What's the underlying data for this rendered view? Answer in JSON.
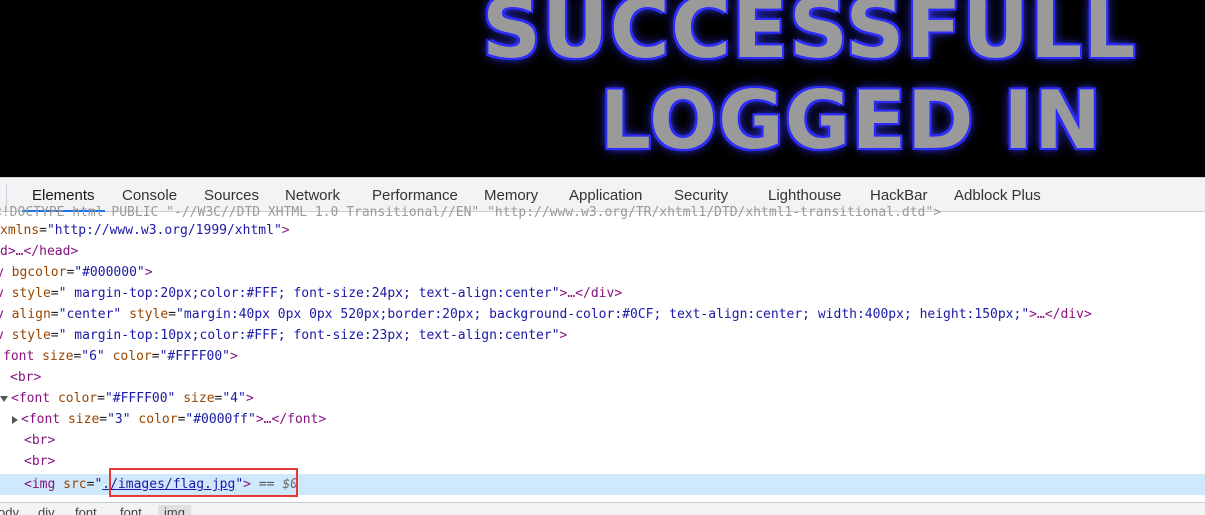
{
  "banner": {
    "line1": "SUCCESSFULL",
    "line2": "LOGGED IN"
  },
  "devtools": {
    "tabs": [
      {
        "label": "Elements",
        "active": true
      },
      {
        "label": "Console"
      },
      {
        "label": "Sources"
      },
      {
        "label": "Network"
      },
      {
        "label": "Performance"
      },
      {
        "label": "Memory"
      },
      {
        "label": "Application"
      },
      {
        "label": "Security"
      },
      {
        "label": "Lighthouse"
      },
      {
        "label": "HackBar"
      },
      {
        "label": "Adblock Plus"
      }
    ],
    "dom": {
      "line0": "<!DOCTYPE html PUBLIC \"-//W3C//DTD XHTML 1.0 Transitional//EN\" \"http://www.w3.org/TR/xhtml1/DTD/xhtml1-transitional.dtd\">",
      "line1_attr": "xmlns",
      "line1_val": "\"http://www.w3.org/1999/xhtml\"",
      "line2": "d>…</head>",
      "line3_tag": "y",
      "line3_attr": "bgcolor",
      "line3_val": "\"#000000\"",
      "line4_attr": "style",
      "line4_val": "\" margin-top:20px;color:#FFF; font-size:24px; text-align:center\"",
      "line5_attr1": "align",
      "line5_val1": "\"center\"",
      "line5_attr2": "style",
      "line5_val2": "\"margin:40px 0px 0px 520px;border:20px; background-color:#0CF; text-align:center; width:400px; height:150px;\"",
      "line6_attr": "style",
      "line6_val": "\" margin-top:10px;color:#FFF; font-size:23px; text-align:center\"",
      "line7_attr1": "size",
      "line7_val1": "\"6\"",
      "line7_attr2": "color",
      "line7_val2": "\"#FFFF00\"",
      "line9_attr1": "color",
      "line9_val1": "\"#FFFF00\"",
      "line9_attr2": "size",
      "line9_val2": "\"4\"",
      "line10_attr1": "size",
      "line10_val1": "\"3\"",
      "line10_attr2": "color",
      "line10_val2": "\"#0000ff\"",
      "img_attr": "src",
      "img_src": "./images/flag.jpg",
      "eq_marker": "==",
      "dollar": "$0"
    },
    "breadcrumbs": [
      "ody",
      "div",
      "font",
      "font",
      "img"
    ]
  }
}
